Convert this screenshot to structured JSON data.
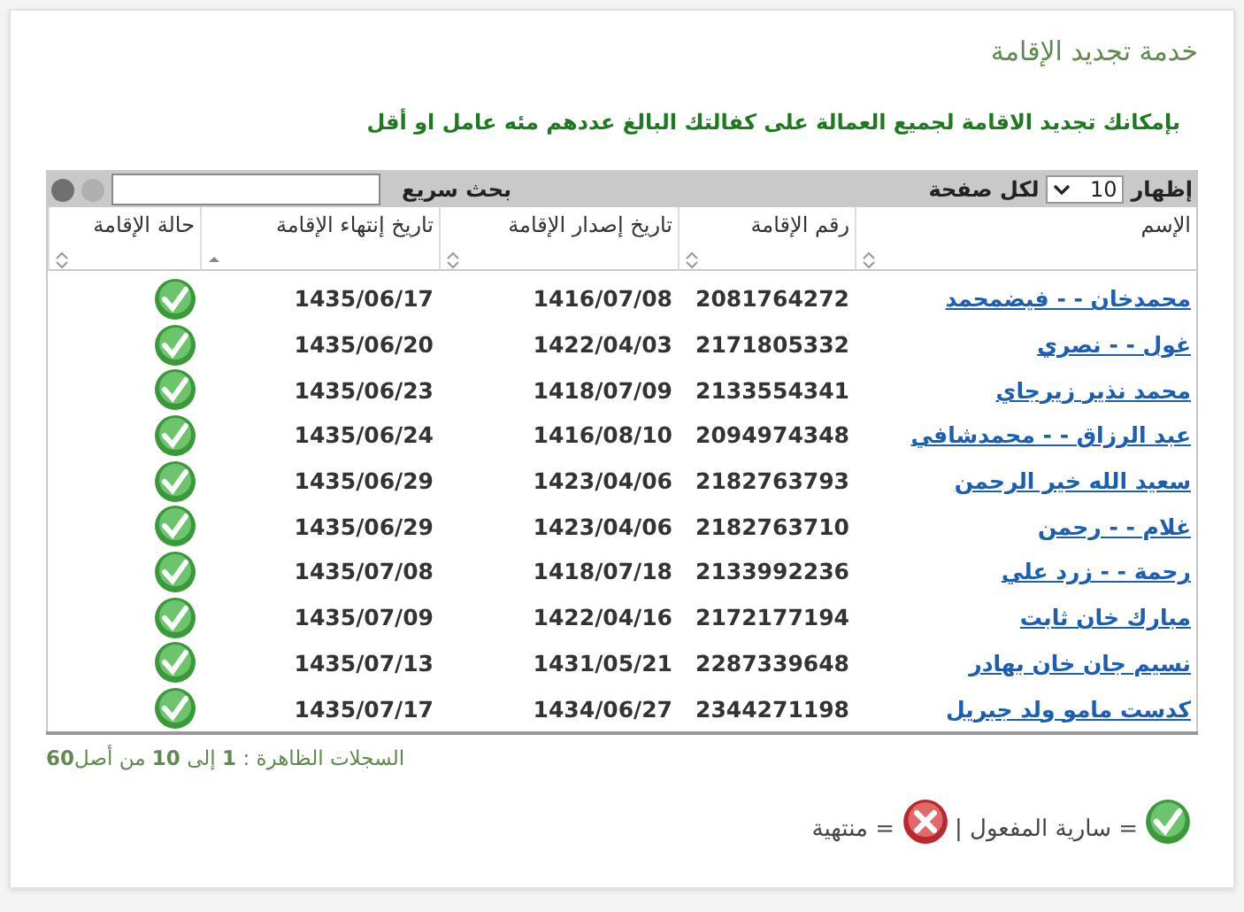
{
  "title": "خدمة تجديد الإقامة",
  "notice": "بإمكانك تجديد الاقامة لجميع العمالة على كفالتك البالغ عددهم مئه عامل او أقل",
  "toolbar": {
    "show_label": "إظهار",
    "page_size": "10",
    "per_page_label": "لكل صفحة",
    "search_label": "بحث سريع"
  },
  "columns": [
    "الإسم",
    "رقم الإقامة",
    "تاريخ إصدار الإقامة",
    "تاريخ إنتهاء الإقامة",
    "حالة الإقامة"
  ],
  "rows": [
    {
      "name": "محمدخان - - فيضمحمد",
      "number": "2081764272",
      "issued": "1416/07/08",
      "expires": "1435/06/17",
      "valid": true
    },
    {
      "name": "غول - - نصري",
      "number": "2171805332",
      "issued": "1422/04/03",
      "expires": "1435/06/20",
      "valid": true
    },
    {
      "name": "محمد نذير زيرجاي",
      "number": "2133554341",
      "issued": "1418/07/09",
      "expires": "1435/06/23",
      "valid": true
    },
    {
      "name": "عبد الرزاق - - محمدشافي",
      "number": "2094974348",
      "issued": "1416/08/10",
      "expires": "1435/06/24",
      "valid": true
    },
    {
      "name": "سعيد الله خير الرحمن",
      "number": "2182763793",
      "issued": "1423/04/06",
      "expires": "1435/06/29",
      "valid": true
    },
    {
      "name": "غلام - - رحمن",
      "number": "2182763710",
      "issued": "1423/04/06",
      "expires": "1435/06/29",
      "valid": true
    },
    {
      "name": "رحمة - - زرد علي",
      "number": "2133992236",
      "issued": "1418/07/18",
      "expires": "1435/07/08",
      "valid": true
    },
    {
      "name": "مبارك خان ثابت",
      "number": "2172177194",
      "issued": "1422/04/16",
      "expires": "1435/07/09",
      "valid": true
    },
    {
      "name": "نسيم جان خان بهادر",
      "number": "2287339648",
      "issued": "1431/05/21",
      "expires": "1435/07/13",
      "valid": true
    },
    {
      "name": "كدست مامو ولد جبريل",
      "number": "2344271198",
      "issued": "1434/06/27",
      "expires": "1435/07/17",
      "valid": true
    }
  ],
  "records_info": "السجلات الظاهرة : **1** إلى **10** من أصل**60**",
  "legend": [
    {
      "valid": true,
      "label": "= سارية المفعول |"
    },
    {
      "valid": false,
      "label": "= منتهية"
    }
  ]
}
